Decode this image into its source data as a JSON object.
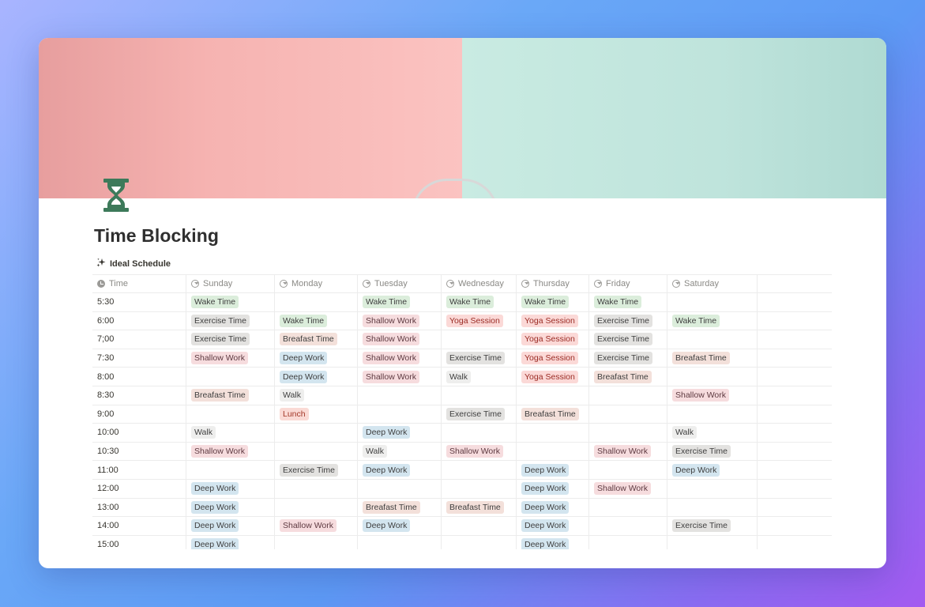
{
  "page": {
    "title": "Time Blocking",
    "view_label": "Ideal Schedule",
    "icon": "hourglass-icon"
  },
  "colors": {
    "Wake Time": "#dbeddb",
    "Exercise Time": "#e3e2e0",
    "Shallow Work": "#f6dcde",
    "Yoga Session": "#fbd9d7",
    "Breafast Time": "#f3e0da",
    "Deep Work": "#d3e5ef",
    "Walk": "#eeeeed",
    "Lunch": "#fadad5"
  },
  "text_colors": {
    "Yoga Session": "#9b2c25",
    "Lunch": "#a43a2b",
    "Shallow Work": "#5e3a41"
  },
  "table": {
    "headers": [
      "Time",
      "Sunday",
      "Monday",
      "Tuesday",
      "Wednesday",
      "Thursday",
      "Friday",
      "Saturday"
    ],
    "rows": [
      [
        "5:30",
        "Wake Time",
        "",
        "Wake Time",
        "Wake Time",
        "Wake Time",
        "Wake Time",
        ""
      ],
      [
        "6:00",
        "Exercise Time",
        "Wake Time",
        "Shallow Work",
        "Yoga Session",
        "Yoga Session",
        "Exercise Time",
        "Wake Time"
      ],
      [
        "7;00",
        "Exercise Time",
        "Breafast Time",
        "Shallow Work",
        "",
        "Yoga Session",
        "Exercise Time",
        ""
      ],
      [
        "7:30",
        "Shallow Work",
        "Deep Work",
        "Shallow Work",
        "Exercise Time",
        "Yoga Session",
        "Exercise Time",
        "Breafast Time"
      ],
      [
        "8:00",
        "",
        "Deep Work",
        "Shallow Work",
        "Walk",
        "Yoga Session",
        "Breafast Time",
        ""
      ],
      [
        "8:30",
        "Breafast Time",
        "Walk",
        "",
        "",
        "",
        "",
        "Shallow Work"
      ],
      [
        "9:00",
        "",
        "Lunch",
        "",
        "Exercise Time",
        "Breafast Time",
        "",
        ""
      ],
      [
        "10:00",
        "Walk",
        "",
        "Deep Work",
        "",
        "",
        "",
        "Walk"
      ],
      [
        "10:30",
        "Shallow Work",
        "",
        "Walk",
        "Shallow Work",
        "",
        "Shallow Work",
        "Exercise Time"
      ],
      [
        "11:00",
        "",
        "Exercise Time",
        "Deep Work",
        "",
        "Deep Work",
        "",
        "Deep Work"
      ],
      [
        "12:00",
        "Deep Work",
        "",
        "",
        "",
        "Deep Work",
        "Shallow Work",
        ""
      ],
      [
        "13:00",
        "Deep Work",
        "",
        "Breafast Time",
        "Breafast Time",
        "Deep Work",
        "",
        ""
      ],
      [
        "14:00",
        "Deep Work",
        "Shallow Work",
        "Deep Work",
        "",
        "Deep Work",
        "",
        "Exercise Time"
      ],
      [
        "15:00",
        "Deep Work",
        "",
        "",
        "",
        "Deep Work",
        "",
        ""
      ]
    ]
  }
}
